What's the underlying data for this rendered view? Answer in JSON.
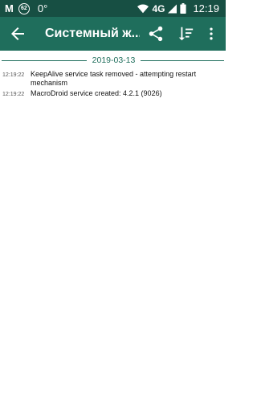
{
  "status_bar": {
    "app_letter": "M",
    "badge": "62",
    "temperature": "0°",
    "network": "4G",
    "time": "12:19"
  },
  "toolbar": {
    "title": "Системный ж...",
    "icons": [
      "arrow-back-icon",
      "share-icon",
      "sort-icon",
      "more-vert-icon"
    ]
  },
  "log": {
    "date": "2019-03-13",
    "entries": [
      {
        "time": "12:19:22",
        "text": "KeepAlive service task removed - attempting restart mechanism"
      },
      {
        "time": "12:19:22",
        "text": "MacroDroid service created: 4.2.1 (9026)"
      }
    ]
  },
  "colors": {
    "status_bar": "#174f43",
    "toolbar": "#1f6e5c",
    "accent": "#1f6e5c"
  }
}
